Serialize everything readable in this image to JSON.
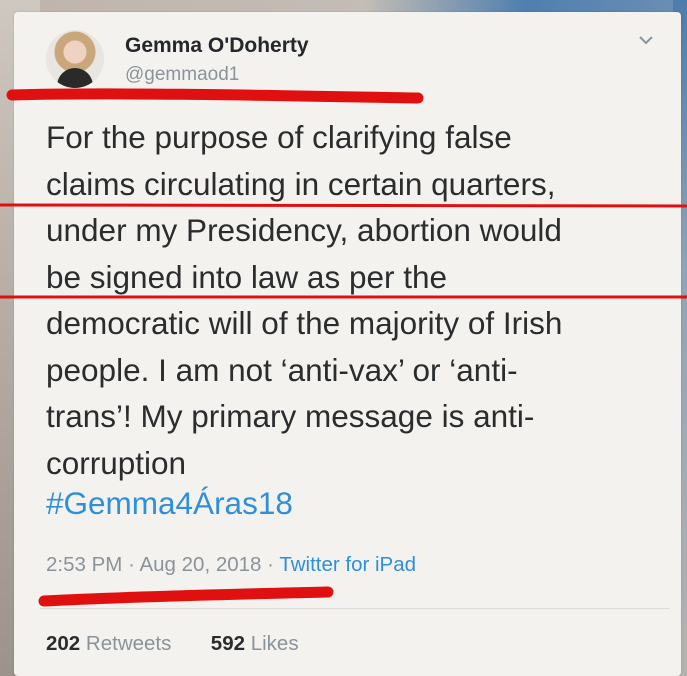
{
  "tweet": {
    "display_name": "Gemma O'Doherty",
    "handle": "@gemmaod1",
    "body_lines": [
      "For the purpose of clarifying false",
      "claims circulating in certain quarters,",
      "under my Presidency, abortion would",
      "be signed into law as per the",
      "democratic will of the majority of Irish",
      "people. I am not ‘anti-vax’ or ‘anti-",
      "trans’! My primary message is anti-",
      "corruption"
    ],
    "hashtag": "#Gemma4Áras18",
    "time": "2:53 PM",
    "date": "Aug 20, 2018",
    "separator": "·",
    "source": "Twitter for iPad",
    "retweets_count": "202",
    "retweets_label": "Retweets",
    "likes_count": "592",
    "likes_label": "Likes"
  },
  "icons": {
    "menu": "chevron-down-icon",
    "avatar": "profile-photo"
  },
  "colors": {
    "card_background": "#f4f2ef",
    "text": "#2a2c2e",
    "muted": "#8a939b",
    "link": "#2f8fd8",
    "annotation_red": "#e01010"
  }
}
